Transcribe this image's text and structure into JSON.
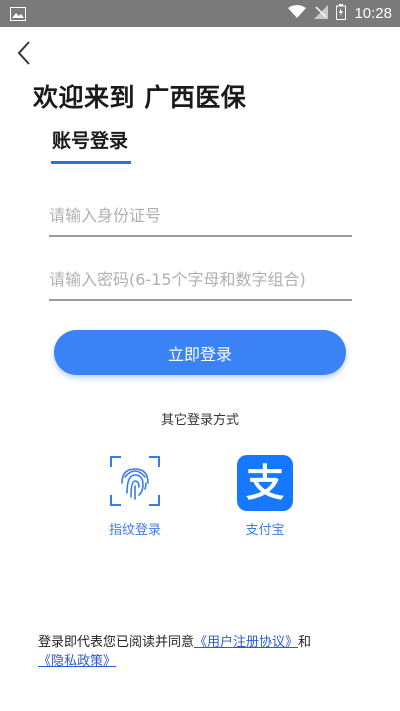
{
  "status_bar": {
    "time": "10:28"
  },
  "header": {
    "welcome": "欢迎来到 广西医保"
  },
  "tabs": {
    "account": "账号登录"
  },
  "form": {
    "id_placeholder": "请输入身份证号",
    "password_placeholder": "请输入密码(6-15个字母和数字组合)",
    "login_label": "立即登录"
  },
  "other_login": {
    "title": "其它登录方式",
    "fingerprint": "指纹登录",
    "alipay": "支付宝",
    "alipay_glyph": "支"
  },
  "agreement": {
    "prefix": "登录即代表您已阅读并同意",
    "user_agreement": "《用户注册协议》",
    "and": "和",
    "privacy": "《隐私政策》"
  },
  "colors": {
    "primary": "#3b82f6",
    "alipay": "#1677ff",
    "status_bar": "#7a7a7a"
  }
}
